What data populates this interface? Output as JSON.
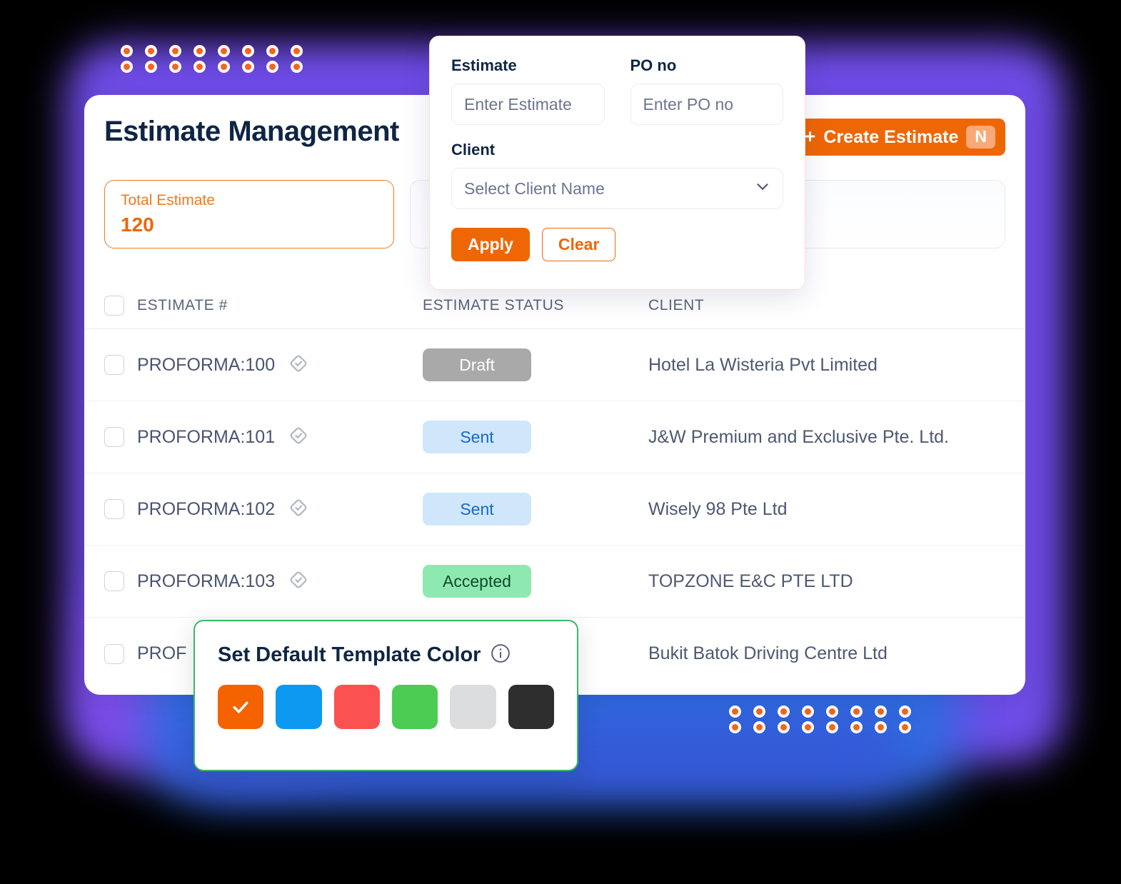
{
  "header": {
    "title": "Estimate Management",
    "create_button": {
      "plus": "+",
      "label": "Create Estimate",
      "shortcut": "N"
    }
  },
  "stats": [
    {
      "label": "Total Estimate",
      "value": "120"
    }
  ],
  "filter_popup": {
    "estimate": {
      "label": "Estimate",
      "placeholder": "Enter Estimate",
      "value": ""
    },
    "po_no": {
      "label": "PO no",
      "placeholder": "Enter PO no",
      "value": ""
    },
    "client": {
      "label": "Client",
      "placeholder": "Select Client Name",
      "value": ""
    },
    "apply_label": "Apply",
    "clear_label": "Clear"
  },
  "table": {
    "columns": {
      "estimate_number": "ESTIMATE #",
      "estimate_status": "ESTIMATE STATUS",
      "client": "CLIENT"
    },
    "rows": [
      {
        "number": "PROFORMA:100",
        "status": "Draft",
        "status_kind": "draft",
        "client": "Hotel La Wisteria Pvt Limited"
      },
      {
        "number": "PROFORMA:101",
        "status": "Sent",
        "status_kind": "sent",
        "client": "J&W Premium and Exclusive Pte. Ltd."
      },
      {
        "number": "PROFORMA:102",
        "status": "Sent",
        "status_kind": "sent",
        "client": "Wisely 98 Pte Ltd"
      },
      {
        "number": "PROFORMA:103",
        "status": "Accepted",
        "status_kind": "accepted",
        "client": "TOPZONE E&C PTE LTD"
      },
      {
        "number": "PROF",
        "status": "",
        "status_kind": "none",
        "client": "Bukit Batok Driving Centre Ltd"
      }
    ]
  },
  "color_modal": {
    "title": "Set Default Template Color",
    "info_icon": "info-icon",
    "swatches": [
      {
        "name": "orange",
        "hex": "#F56300",
        "selected": true
      },
      {
        "name": "blue",
        "hex": "#0D99F2",
        "selected": false
      },
      {
        "name": "red",
        "hex": "#FB5151",
        "selected": false
      },
      {
        "name": "green",
        "hex": "#4CCC53",
        "selected": false
      },
      {
        "name": "light-gray",
        "hex": "#DCDDDE",
        "selected": false
      },
      {
        "name": "dark",
        "hex": "#2E2E2E",
        "selected": false
      }
    ]
  },
  "theme": {
    "accent_orange": "#EF6605",
    "title_navy": "#0F2544",
    "glow_purple": "#6F4CE8",
    "glow_blue": "#2D6DE0",
    "modal_green": "#3BB76A",
    "dot_orange": "#F26522"
  },
  "decor": {
    "dot_grid_rows": 2,
    "dot_grid_cols": 8
  }
}
